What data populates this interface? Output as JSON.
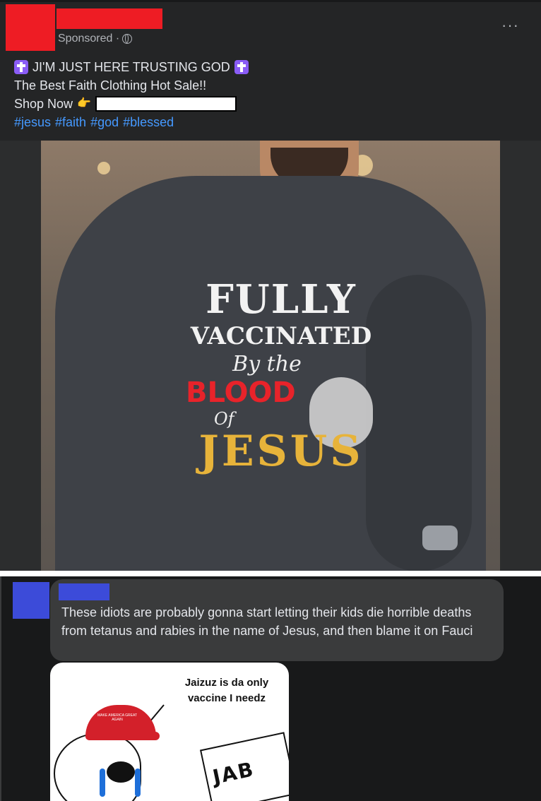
{
  "post": {
    "sponsored_label": "Sponsored ·",
    "more_icon": "···",
    "caption_line1": "JI'M JUST HERE TRUSTING GOD",
    "caption_line2": "The Best Faith Clothing Hot Sale!!",
    "caption_line3": "Shop Now",
    "thumb_emoji": "👉",
    "hashtags": [
      "#jesus",
      "#faith",
      "#god",
      "#blessed"
    ],
    "colors": {
      "redacted": "#ee1c24",
      "hashtag": "#4599ff",
      "background": "#242526"
    }
  },
  "shirt": {
    "line1": "FULLY",
    "line2": "VACCINATED",
    "line3": "By the",
    "line4": "BLOOD",
    "line5": "Of",
    "line6": "JESUS"
  },
  "comment": {
    "text": "These idiots are probably gonna start letting their kids die horrible deaths from tetanus and rabies in the name of Jesus, and then blame it on Fauci",
    "colors": {
      "redacted": "#3c4bd9"
    }
  },
  "meme": {
    "speech": "Jaizuz is da only vaccine I needz",
    "hat_text": "MAKE AMERICA GREAT AGAIN",
    "box_text": "JAB"
  }
}
